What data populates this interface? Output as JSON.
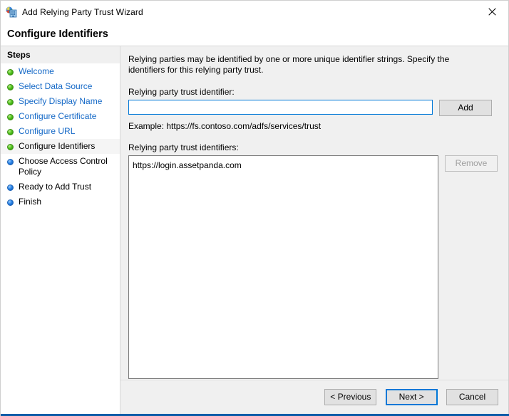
{
  "window": {
    "title": "Add Relying Party Trust Wizard",
    "icon": "adfs-wizard-icon",
    "close_label": "✕",
    "accent_color": "#0b5ca8"
  },
  "page": {
    "heading": "Configure Identifiers"
  },
  "sidebar": {
    "header": "Steps",
    "items": [
      {
        "label": "Welcome",
        "state": "done"
      },
      {
        "label": "Select Data Source",
        "state": "done"
      },
      {
        "label": "Specify Display Name",
        "state": "done"
      },
      {
        "label": "Configure Certificate",
        "state": "done"
      },
      {
        "label": "Configure URL",
        "state": "done"
      },
      {
        "label": "Configure Identifiers",
        "state": "current"
      },
      {
        "label": "Choose Access Control Policy",
        "state": "pending"
      },
      {
        "label": "Ready to Add Trust",
        "state": "pending"
      },
      {
        "label": "Finish",
        "state": "pending"
      }
    ]
  },
  "main": {
    "intro": "Relying parties may be identified by one or more unique identifier strings. Specify the identifiers for this relying party trust.",
    "identifier_label": "Relying party trust identifier:",
    "identifier_value": "",
    "identifier_placeholder": "",
    "add_button": "Add",
    "example_text": "Example: https://fs.contoso.com/adfs/services/trust",
    "identifiers_label": "Relying party trust identifiers:",
    "remove_button": "Remove",
    "remove_disabled": true,
    "identifiers": [
      "https://login.assetpanda.com"
    ]
  },
  "footer": {
    "previous_button": "< Previous",
    "next_button": "Next >",
    "cancel_button": "Cancel"
  }
}
